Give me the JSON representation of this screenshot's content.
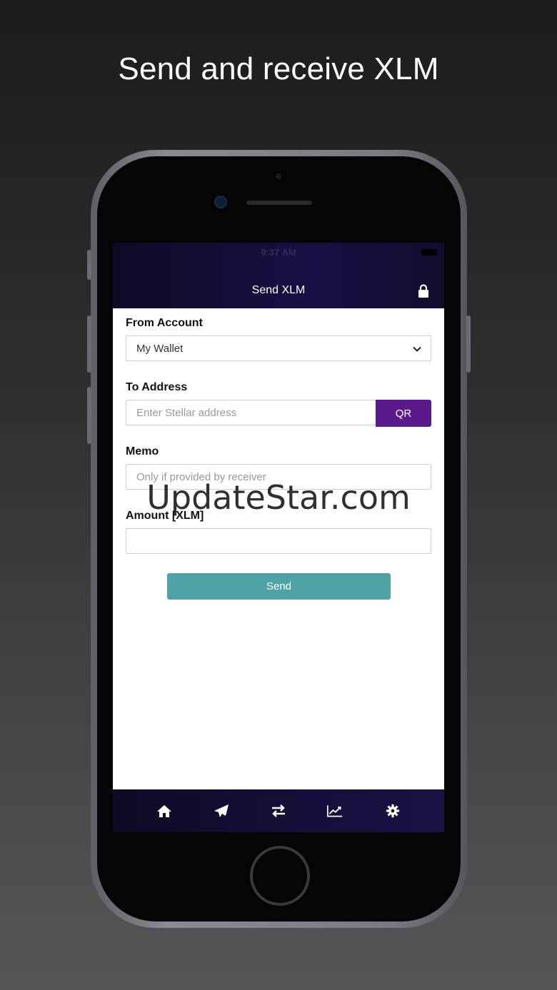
{
  "headline": "Send and receive XLM",
  "status_bar": {
    "time": "9:37 AM"
  },
  "nav": {
    "title": "Send XLM",
    "lock_icon": "lock-icon"
  },
  "form": {
    "from_account": {
      "label": "From Account",
      "value": "My Wallet"
    },
    "to_address": {
      "label": "To Address",
      "placeholder": "Enter Stellar address",
      "qr_label": "QR"
    },
    "memo": {
      "label": "Memo",
      "placeholder": "Only if provided by receiver"
    },
    "amount": {
      "label": "Amount [XLM]",
      "value": ""
    },
    "send_label": "Send"
  },
  "tabbar": {
    "items": [
      {
        "icon": "home-icon"
      },
      {
        "icon": "send-plane-icon"
      },
      {
        "icon": "exchange-arrows-icon"
      },
      {
        "icon": "chart-line-icon"
      },
      {
        "icon": "gear-icon"
      }
    ]
  },
  "watermark": "UpdateStar.com",
  "colors": {
    "accent_purple": "#5a1a8c",
    "send_teal": "#4ea3a5",
    "nav_dark": "#140e38"
  }
}
